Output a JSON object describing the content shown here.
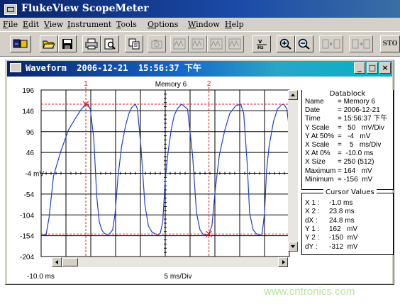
{
  "app": {
    "title": "FlukeView ScopeMeter"
  },
  "menu": {
    "items": [
      "File",
      "Edit",
      "View",
      "Instrument",
      "Tools",
      "Options",
      "Window",
      "Help"
    ]
  },
  "toolbar": {
    "buttons": [
      {
        "name": "instrument-connect-button",
        "icon": "scope-icon"
      },
      {
        "name": "open-button",
        "icon": "folder-open-icon"
      },
      {
        "name": "save-button",
        "icon": "floppy-disk-icon"
      },
      {
        "name": "print-button",
        "icon": "printer-icon"
      },
      {
        "name": "print-preview-button",
        "icon": "print-preview-icon"
      },
      {
        "name": "copy-button",
        "icon": "copy-icon"
      },
      {
        "name": "camera-button",
        "icon": "camera-icon"
      },
      {
        "name": "waveform-a-button",
        "icon": "waveform-icon"
      },
      {
        "name": "waveform-b-button",
        "icon": "waveform-icon"
      },
      {
        "name": "waveform-c-button",
        "icon": "waveform-icon"
      },
      {
        "name": "waveform-d-button",
        "icon": "waveform-icon"
      },
      {
        "name": "volt-hertz-button",
        "icon": "volt-hertz-icon"
      },
      {
        "name": "zoom-in-button",
        "icon": "zoom-in-icon"
      },
      {
        "name": "zoom-out-button",
        "icon": "zoom-out-icon"
      },
      {
        "name": "cursor-left-button",
        "icon": "cursor-left-icon"
      },
      {
        "name": "cursor-right-button",
        "icon": "cursor-right-icon"
      },
      {
        "name": "stop-button",
        "label": "STO"
      }
    ]
  },
  "window": {
    "title": "Waveform  2006-12-21  15:56:37 下午",
    "controls": {
      "minimize": "_",
      "maximize": "□",
      "close": "×"
    }
  },
  "chart_data": {
    "type": "line",
    "title": "Memory 6",
    "xlabel": "5 ms/Div",
    "x_start_label": "-10.0 ms",
    "ylim": [
      -204,
      196
    ],
    "y_tick_labels": [
      "196",
      "146",
      "96",
      "46",
      "-4 mV",
      "-54",
      "-104",
      "-154",
      "-204"
    ],
    "y_ticks": [
      196,
      146,
      96,
      46,
      -4,
      -54,
      -104,
      -154,
      -204
    ],
    "xlim": [
      -10.0,
      40.0
    ],
    "grid": true,
    "cursors": [
      {
        "label": "1",
        "x": -1.0,
        "y": 162
      },
      {
        "label": "2",
        "x": 23.8,
        "y": -150
      }
    ],
    "series": [
      {
        "color": "#1f3fd0",
        "x": [
          -10.0,
          -9.0,
          -8.4,
          -7.5,
          -6.0,
          -4.5,
          -3.0,
          -1.9,
          -1.2,
          -0.6,
          -0.1,
          0.6,
          1.2,
          1.7,
          2.2,
          2.7,
          3.0,
          3.4,
          3.9,
          4.4,
          4.9,
          5.5,
          6.2,
          7.0,
          7.7,
          8.3,
          9.0,
          9.4,
          10.1,
          10.9,
          11.6,
          12.3,
          13.0,
          13.6,
          14.0,
          14.5,
          15.0,
          15.6,
          16.2,
          16.8,
          17.5,
          18.3,
          19.5,
          20.5,
          21.3,
          22.0,
          22.6,
          23.3,
          23.8,
          24.4,
          25.1,
          25.9,
          27.0,
          28.0,
          29.2,
          30.2,
          30.8,
          31.5,
          32.0,
          32.7,
          33.4,
          34.0,
          34.5,
          35.0,
          35.4,
          35.9,
          36.8,
          37.6,
          38.4,
          38.9,
          39.5,
          40.0
        ],
        "values": [
          -150,
          -152,
          -110,
          -10,
          50,
          100,
          130,
          150,
          158,
          162,
          150,
          80,
          -60,
          -120,
          -140,
          -148,
          -150,
          -152,
          -148,
          -140,
          -100,
          -10,
          60,
          110,
          140,
          155,
          162,
          150,
          60,
          -80,
          -130,
          -145,
          -150,
          -152,
          -148,
          -120,
          -20,
          50,
          100,
          135,
          152,
          162,
          150,
          40,
          -100,
          -140,
          -150,
          -152,
          -150,
          -130,
          -40,
          40,
          100,
          140,
          158,
          162,
          140,
          20,
          -100,
          -140,
          -150,
          -152,
          -150,
          -100,
          0,
          60,
          120,
          150,
          160,
          162,
          150,
          100
        ]
      }
    ]
  },
  "datablock": {
    "title": "Datablock",
    "rows": [
      [
        "Name",
        "= Memory 6"
      ],
      [
        "Date",
        "= 2006-12-21"
      ],
      [
        "Time",
        "= 15:56:37 下午"
      ],
      [
        "Y Scale",
        "=   50   mV/Div"
      ],
      [
        "Y At 50%",
        "=   -4   mV"
      ],
      [
        "X Scale",
        "=    5   ms/Div"
      ],
      [
        "X At 0%",
        "=  -10.0 ms"
      ],
      [
        "X Size",
        "= 250 (512)"
      ],
      [
        "Maximum",
        "= 164   mV"
      ],
      [
        "Minimum",
        "= -156  mV"
      ]
    ]
  },
  "cursor_values": {
    "title": "Cursor Values",
    "rows": [
      [
        "X 1 :",
        "-1.0 ms"
      ],
      [
        "X 2 :",
        "23.8 ms"
      ],
      [
        "dX :",
        "24.8 ms"
      ],
      [
        "Y 1 :",
        "162   mV"
      ],
      [
        "Y 2 :",
        "-150  mV"
      ],
      [
        "dY :",
        "-312  mV"
      ]
    ]
  },
  "watermark": "www.cntronics.com",
  "colors": {
    "title_bar": "#0a246a",
    "child_title_gradient_end": "#00b4c4",
    "trace": "#1f3fd0",
    "cursor": "#e02020",
    "grid": "#000000"
  }
}
